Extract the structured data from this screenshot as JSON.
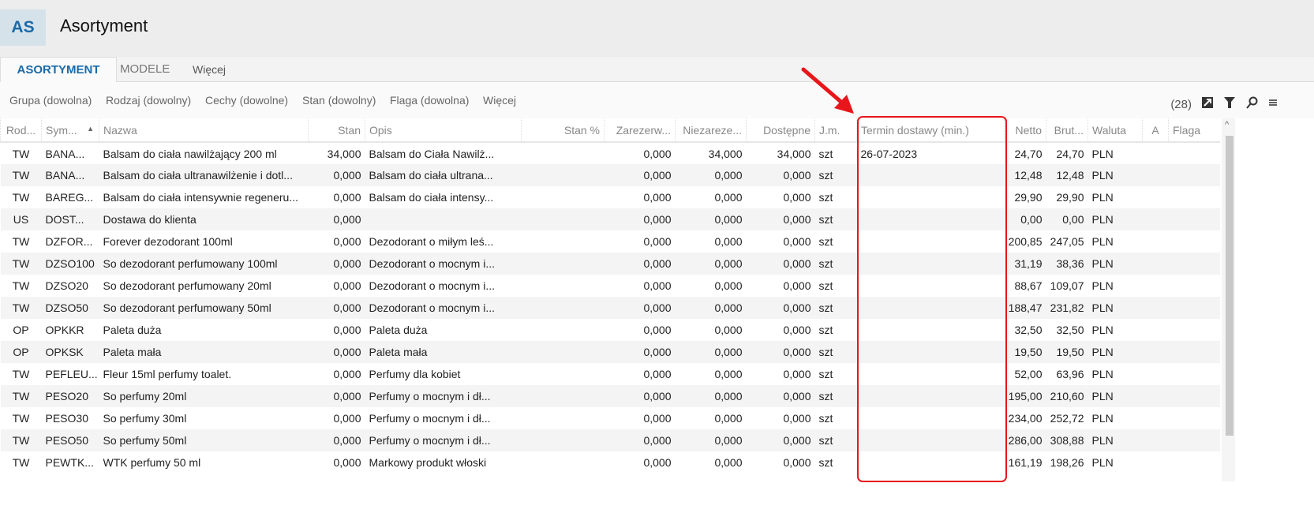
{
  "app": {
    "logo": "AS",
    "title": "Asortyment"
  },
  "tabs": [
    "ASORTYMENT",
    "MODELE",
    "Więcej"
  ],
  "filters": [
    "Grupa (dowolna)",
    "Rodzaj (dowolny)",
    "Cechy (dowolne)",
    "Stan (dowolny)",
    "Flaga (dowolna)",
    "Więcej"
  ],
  "toolbar": {
    "count": "(28)"
  },
  "columns": [
    "Rod...",
    "Sym...",
    "Nazwa",
    "Stan",
    "Opis",
    "Stan %",
    "Zarezerw...",
    "Niezareze...",
    "Dostępne",
    "J.m.",
    "Termin dostawy (min.)",
    "Netto",
    "Brut...",
    "Waluta",
    "A",
    "Flaga"
  ],
  "rows": [
    [
      "TW",
      "BANA...",
      "Balsam do ciała nawilżający 200 ml",
      "34,000",
      "Balsam do Ciała Nawilż...",
      "",
      "0,000",
      "34,000",
      "34,000",
      "szt",
      "26-07-2023",
      "24,70",
      "24,70",
      "PLN",
      "",
      ""
    ],
    [
      "TW",
      "BANA...",
      "Balsam do ciała ultranawilżenie i dotl...",
      "0,000",
      "Balsam do ciała ultrana...",
      "",
      "0,000",
      "0,000",
      "0,000",
      "szt",
      "",
      "12,48",
      "12,48",
      "PLN",
      "",
      ""
    ],
    [
      "TW",
      "BAREG...",
      "Balsam do ciała intensywnie regeneru...",
      "0,000",
      "Balsam do ciała intensy...",
      "",
      "0,000",
      "0,000",
      "0,000",
      "szt",
      "",
      "29,90",
      "29,90",
      "PLN",
      "",
      ""
    ],
    [
      "US",
      "DOST...",
      "Dostawa do klienta",
      "0,000",
      "",
      "",
      "0,000",
      "0,000",
      "0,000",
      "szt",
      "",
      "0,00",
      "0,00",
      "PLN",
      "",
      ""
    ],
    [
      "TW",
      "DZFOR...",
      "Forever dezodorant 100ml",
      "0,000",
      "Dezodorant o miłym leś...",
      "",
      "0,000",
      "0,000",
      "0,000",
      "szt",
      "",
      "200,85",
      "247,05",
      "PLN",
      "",
      ""
    ],
    [
      "TW",
      "DZSO100",
      "So dezodorant perfumowany 100ml",
      "0,000",
      "Dezodorant o mocnym i...",
      "",
      "0,000",
      "0,000",
      "0,000",
      "szt",
      "",
      "31,19",
      "38,36",
      "PLN",
      "",
      ""
    ],
    [
      "TW",
      "DZSO20",
      "So dezodorant perfumowany 20ml",
      "0,000",
      "Dezodorant o mocnym i...",
      "",
      "0,000",
      "0,000",
      "0,000",
      "szt",
      "",
      "88,67",
      "109,07",
      "PLN",
      "",
      ""
    ],
    [
      "TW",
      "DZSO50",
      "So dezodorant perfumowany 50ml",
      "0,000",
      "Dezodorant o mocnym i...",
      "",
      "0,000",
      "0,000",
      "0,000",
      "szt",
      "",
      "188,47",
      "231,82",
      "PLN",
      "",
      ""
    ],
    [
      "OP",
      "OPKKR",
      "Paleta duża",
      "0,000",
      "Paleta duża",
      "",
      "0,000",
      "0,000",
      "0,000",
      "szt",
      "",
      "32,50",
      "32,50",
      "PLN",
      "",
      ""
    ],
    [
      "OP",
      "OPKSK",
      "Paleta mała",
      "0,000",
      "Paleta mała",
      "",
      "0,000",
      "0,000",
      "0,000",
      "szt",
      "",
      "19,50",
      "19,50",
      "PLN",
      "",
      ""
    ],
    [
      "TW",
      "PEFLEU...",
      "Fleur 15ml perfumy toalet.",
      "0,000",
      "Perfumy dla kobiet",
      "",
      "0,000",
      "0,000",
      "0,000",
      "szt",
      "",
      "52,00",
      "63,96",
      "PLN",
      "",
      ""
    ],
    [
      "TW",
      "PESO20",
      "So perfumy 20ml",
      "0,000",
      "Perfumy o mocnym i dł...",
      "",
      "0,000",
      "0,000",
      "0,000",
      "szt",
      "",
      "195,00",
      "210,60",
      "PLN",
      "",
      ""
    ],
    [
      "TW",
      "PESO30",
      "So perfumy 30ml",
      "0,000",
      "Perfumy o mocnym i dł...",
      "",
      "0,000",
      "0,000",
      "0,000",
      "szt",
      "",
      "234,00",
      "252,72",
      "PLN",
      "",
      ""
    ],
    [
      "TW",
      "PESO50",
      "So perfumy 50ml",
      "0,000",
      "Perfumy o mocnym i dł...",
      "",
      "0,000",
      "0,000",
      "0,000",
      "szt",
      "",
      "286,00",
      "308,88",
      "PLN",
      "",
      ""
    ],
    [
      "TW",
      "PEWTK...",
      "WTK perfumy 50 ml",
      "0,000",
      "Markowy produkt włoski",
      "",
      "0,000",
      "0,000",
      "0,000",
      "szt",
      "",
      "161,19",
      "198,26",
      "PLN",
      "",
      ""
    ]
  ],
  "colors": {
    "accent": "#1a6aa8",
    "annotation": "#e8161b"
  }
}
